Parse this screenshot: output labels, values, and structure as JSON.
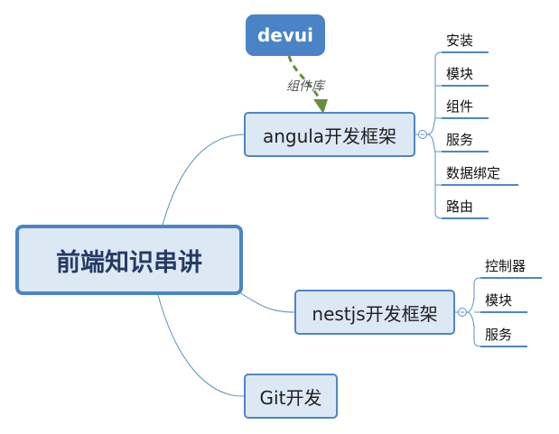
{
  "root": {
    "label": "前端知识串讲"
  },
  "top_node": {
    "label": "devui"
  },
  "relation_label": "组件库",
  "branches": {
    "angular": {
      "label": "angula开发框架",
      "children": [
        "安装",
        "模块",
        "组件",
        "服务",
        "数据绑定",
        "路由"
      ]
    },
    "nest": {
      "label": "nestjs开发框架",
      "children": [
        "控制器",
        "模块",
        "服务"
      ]
    },
    "git": {
      "label": "Git开发"
    }
  },
  "colors": {
    "node_fill": "#dde8f5",
    "node_border": "#4e86c5",
    "accent": "#4a84c6",
    "arrow": "#6b8e3d",
    "line": "#5b8fc9"
  }
}
